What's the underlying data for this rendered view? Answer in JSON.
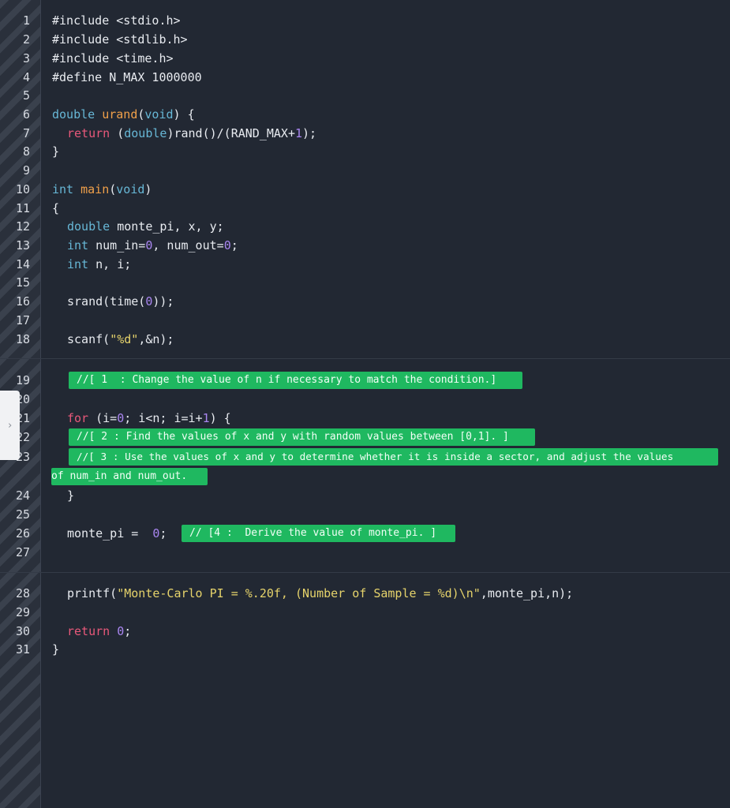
{
  "editor": {
    "lines": [
      {
        "n": "1",
        "text": "#include <stdio.h>"
      },
      {
        "n": "2",
        "text": "#include <stdlib.h>"
      },
      {
        "n": "3",
        "text": "#include <time.h>"
      },
      {
        "n": "4",
        "text": "#define N_MAX 1000000"
      },
      {
        "n": "5",
        "text": ""
      },
      {
        "n": "6",
        "pre": "double ",
        "fn": "urand",
        "mid": "(",
        "kw2": "void",
        "post": ") {"
      },
      {
        "n": "7",
        "ret": "return ",
        "pre": "(",
        "kw": "double",
        "post": ")rand()/(RAND_MAX+",
        "num": "1",
        "tail": ");"
      },
      {
        "n": "8",
        "text": "}"
      },
      {
        "n": "9",
        "text": ""
      },
      {
        "n": "10",
        "kw": "int ",
        "fn": "main",
        "mid": "(",
        "kw2": "void",
        "post": ")"
      },
      {
        "n": "11",
        "text": "{"
      },
      {
        "n": "12",
        "kw": "double",
        "post": " monte_pi, x, y;"
      },
      {
        "n": "13",
        "kw": "int",
        "pre": " num_in=",
        "num": "0",
        "mid": ", num_out=",
        "num2": "0",
        "tail": ";"
      },
      {
        "n": "14",
        "kw": "int",
        "post": " n, i;"
      },
      {
        "n": "15",
        "text": ""
      },
      {
        "n": "16",
        "pre": "srand(time(",
        "num": "0",
        "tail": "));"
      },
      {
        "n": "17",
        "text": ""
      },
      {
        "n": "18",
        "pre": "scanf(",
        "str": "\"%d\"",
        "tail": ",&n);"
      },
      {
        "n": "19",
        "text": ""
      },
      {
        "n": "20",
        "text": ""
      },
      {
        "n": "21",
        "kw": "for",
        "pre": " (i=",
        "num": "0",
        "mid": "; i<n; i=i+",
        "num2": "1",
        "tail": ") {"
      },
      {
        "n": "22",
        "text": ""
      },
      {
        "n": "23",
        "text": ""
      },
      {
        "n": "24",
        "text": "}"
      },
      {
        "n": "25",
        "text": ""
      },
      {
        "n": "26",
        "pre": "monte_pi =  ",
        "num": "0",
        "tail": ";"
      },
      {
        "n": "27",
        "text": ""
      },
      {
        "n": "28",
        "pre": "printf(",
        "str": "\"Monte-Carlo PI = %.20f, (Number of Sample = %d)\\n\"",
        "tail": ",monte_pi,n);"
      },
      {
        "n": "29",
        "text": ""
      },
      {
        "n": "30",
        "ret": "return ",
        "num": "0",
        "tail": ";"
      },
      {
        "n": "31",
        "text": "}"
      }
    ],
    "highlights": {
      "h1": "//[ 1  : Change the value of n if necessary to match the condition.]",
      "h2": "//[ 2 : Find the values of x and y with random values between [0,1]. ]",
      "h3a": "//[ 3 : Use the values of x and y to determine whether it is inside a sector, and adjust the values",
      "h3b": "of num_in and num_out. ",
      "h4": "// [4 :  Derive the value of monte_pi. ]"
    },
    "colors": {
      "background": "#222833",
      "keyword": "#67b7d6",
      "return": "#e8587a",
      "function": "#f0a04a",
      "number": "#a986f0",
      "string": "#e6d36b",
      "highlight": "#1fb860"
    }
  },
  "side_tab": {
    "icon": "chevron-right-icon",
    "glyph": "›"
  }
}
